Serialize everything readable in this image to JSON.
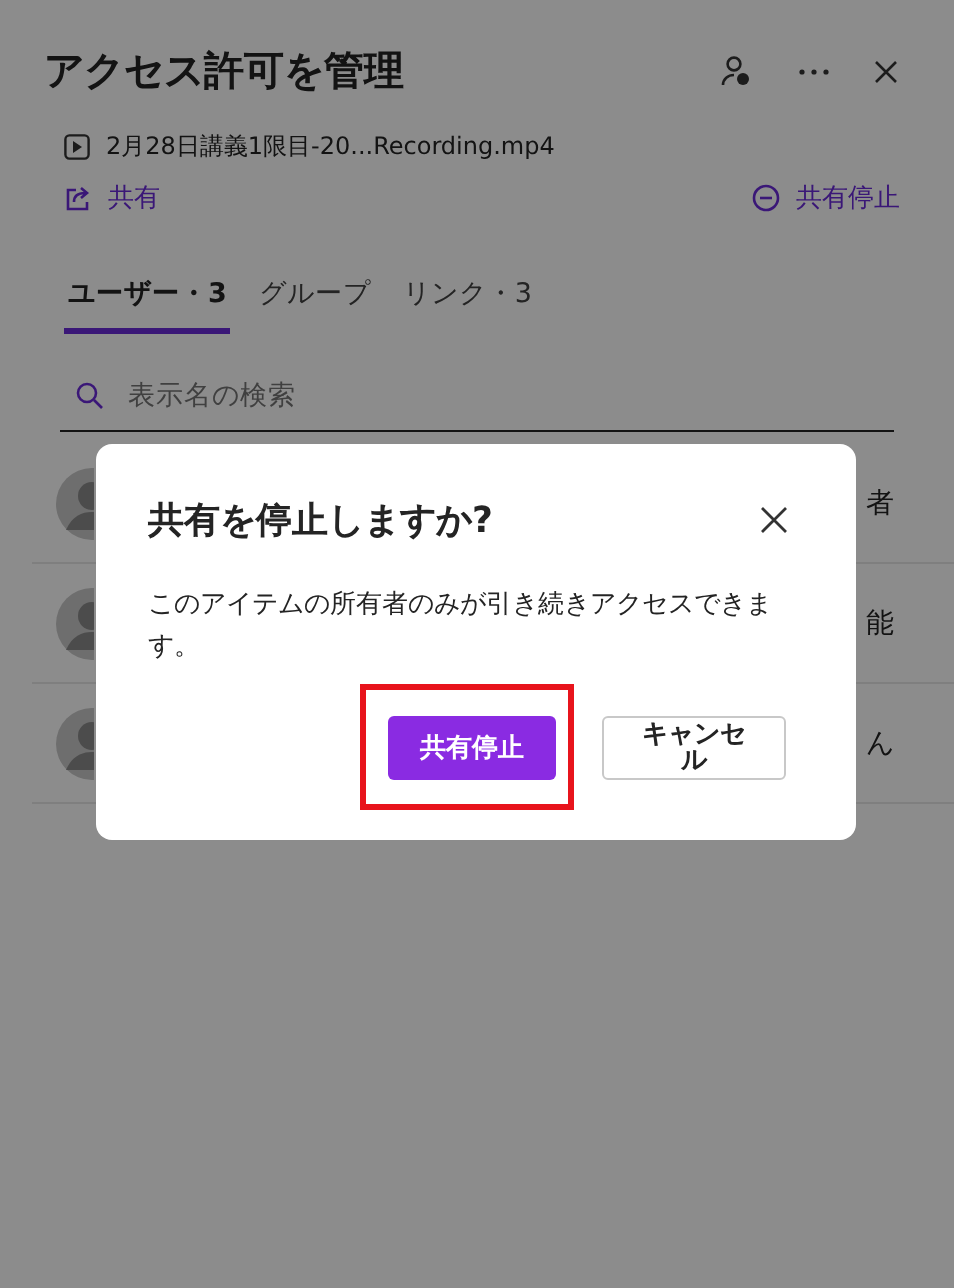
{
  "panel": {
    "title": "アクセス許可を管理",
    "file_name": "2月28日講義1限目-20...Recording.mp4",
    "share_link": "共有",
    "stop_sharing_link": "共有停止"
  },
  "tabs": [
    {
      "label": "ユーザー・3",
      "selected": true
    },
    {
      "label": "グループ",
      "selected": false
    },
    {
      "label": "リンク・3",
      "selected": false
    }
  ],
  "search": {
    "placeholder": "表示名の検索"
  },
  "users": [
    {
      "role": "者"
    },
    {
      "role": "能"
    },
    {
      "role": "ん"
    }
  ],
  "dialog": {
    "title": "共有を停止しますか?",
    "message": "このアイテムの所有者のみが引き続きアクセスできます。",
    "buttons": [
      {
        "label": "共有停止",
        "kind": "primary",
        "highlighted": true
      },
      {
        "label": "キャンセル",
        "kind": "secondary",
        "highlighted": false
      }
    ]
  }
}
